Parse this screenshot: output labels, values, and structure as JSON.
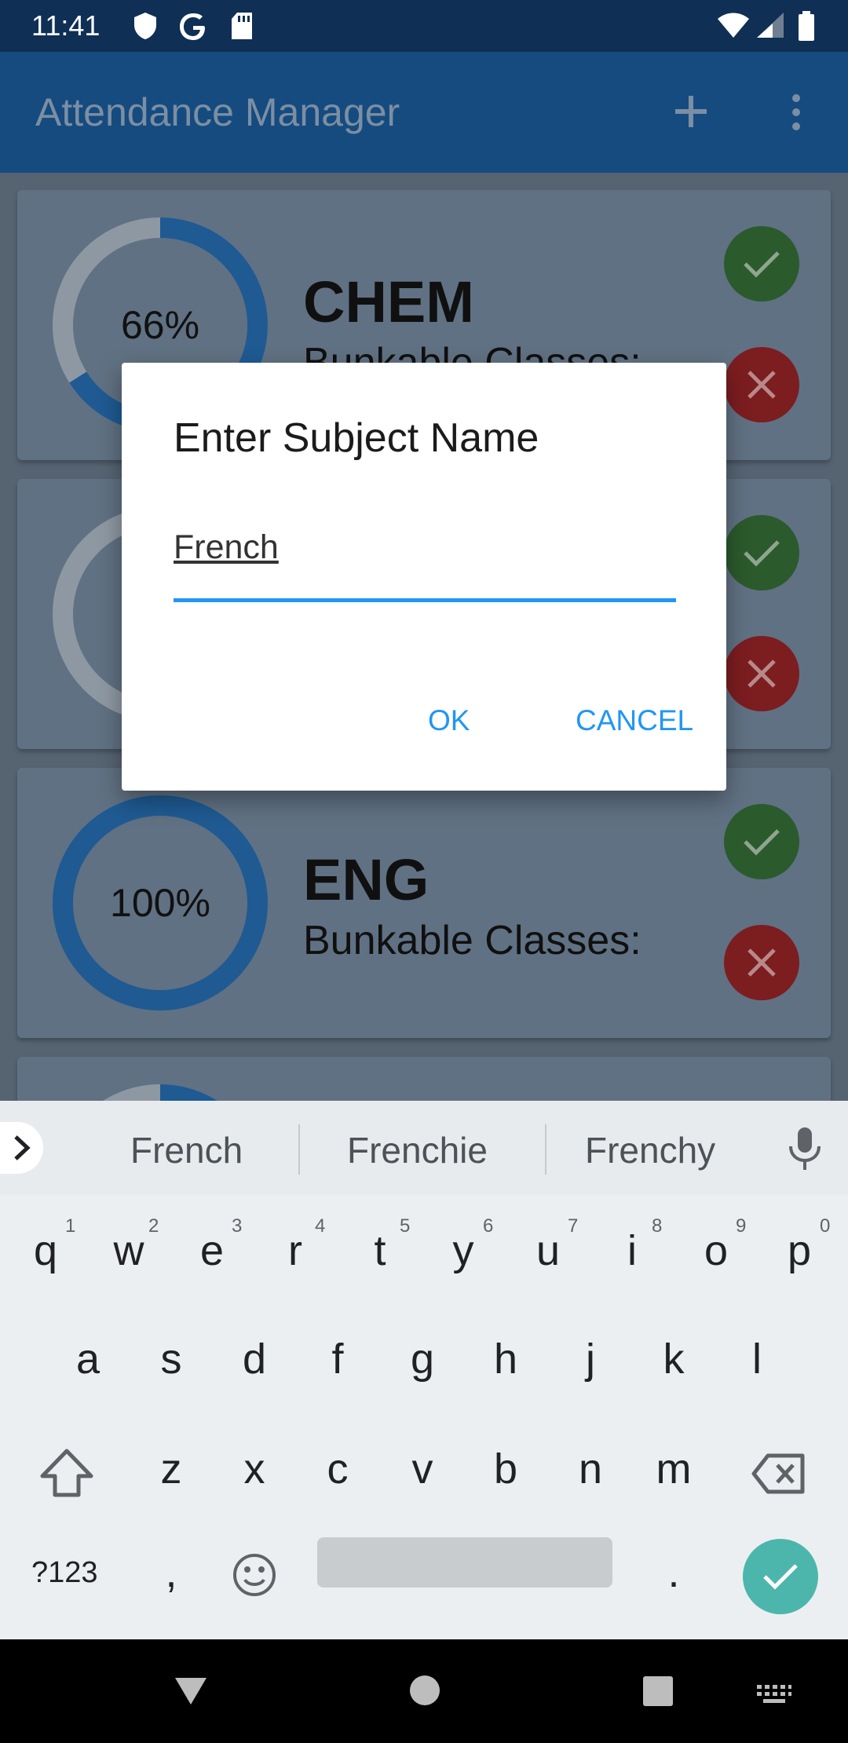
{
  "status_bar": {
    "time": "11:41",
    "icons": [
      "shield-icon",
      "google-icon",
      "sd-card-icon",
      "wifi-icon",
      "signal-icon",
      "battery-icon"
    ]
  },
  "app_bar": {
    "title": "Attendance Manager",
    "icons": [
      "add-icon",
      "overflow-menu-icon"
    ]
  },
  "subjects": [
    {
      "name": "CHEM",
      "percent": "66%",
      "percent_value": 66,
      "bunkable_label": "Bunkable Classes:"
    },
    {
      "name": "",
      "percent": "",
      "percent_value": 0,
      "bunkable_label": ""
    },
    {
      "name": "ENG",
      "percent": "100%",
      "percent_value": 100,
      "bunkable_label": "Bunkable Classes:"
    }
  ],
  "dialog": {
    "title": "Enter Subject Name",
    "input_value": "French",
    "ok_label": "OK",
    "cancel_label": "CANCEL"
  },
  "keyboard": {
    "suggestions": [
      "French",
      "Frenchie",
      "Frenchy"
    ],
    "row1": [
      "q",
      "w",
      "e",
      "r",
      "t",
      "y",
      "u",
      "i",
      "o",
      "p"
    ],
    "row1_digits": [
      "1",
      "2",
      "3",
      "4",
      "5",
      "6",
      "7",
      "8",
      "9",
      "0"
    ],
    "row2": [
      "a",
      "s",
      "d",
      "f",
      "g",
      "h",
      "j",
      "k",
      "l"
    ],
    "row3": [
      "z",
      "x",
      "c",
      "v",
      "b",
      "n",
      "m"
    ],
    "symbols_label": "?123",
    "comma": ",",
    "period": "."
  },
  "colors": {
    "accent": "#2196f3",
    "status_bar": "#0f2f55",
    "app_bar": "#154b7f",
    "check_green": "#2b5a2c",
    "cross_red": "#7c1d20",
    "enter_teal": "#4db6ac"
  }
}
